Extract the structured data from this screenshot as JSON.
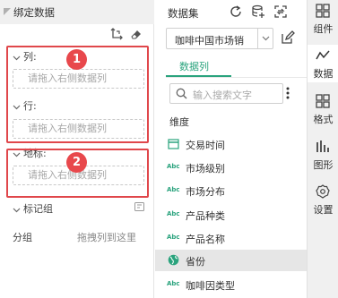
{
  "left_panel": {
    "title": "绑定数据",
    "column_label": "列:",
    "column_placeholder": "请拖入右侧数据列",
    "row_label": "行:",
    "row_placeholder": "请拖入右侧数据列",
    "geo_label": "地标:",
    "geo_placeholder": "请拖入右侧数据列",
    "mark_group": "标记组",
    "group_label": "分组",
    "group_hint": "拖拽列到这里",
    "annotations": [
      "1",
      "2"
    ]
  },
  "dataset_panel": {
    "title": "数据集",
    "dataset_value": "咖啡中国市场销",
    "tab_label": "数据列",
    "search_placeholder": "输入搜索文字",
    "dimension_title": "维度",
    "fields": [
      {
        "label": "交易时间",
        "type": "date"
      },
      {
        "label": "市场级别",
        "type": "text"
      },
      {
        "label": "市场分布",
        "type": "text"
      },
      {
        "label": "产品种类",
        "type": "text"
      },
      {
        "label": "产品名称",
        "type": "text"
      },
      {
        "label": "省份",
        "type": "geo",
        "selected": true
      },
      {
        "label": "咖啡因类型",
        "type": "text"
      }
    ],
    "abc_text": "Abc"
  },
  "right_sidebar": {
    "items": [
      {
        "label": "组件",
        "icon": "component-icon"
      },
      {
        "label": "数据",
        "icon": "data-icon",
        "active": true
      },
      {
        "label": "格式",
        "icon": "format-icon"
      },
      {
        "label": "图形",
        "icon": "graph-icon"
      },
      {
        "label": "设置",
        "icon": "settings-icon"
      }
    ]
  },
  "colors": {
    "accent": "#2aa37d",
    "annotation_red": "#e0474b"
  }
}
